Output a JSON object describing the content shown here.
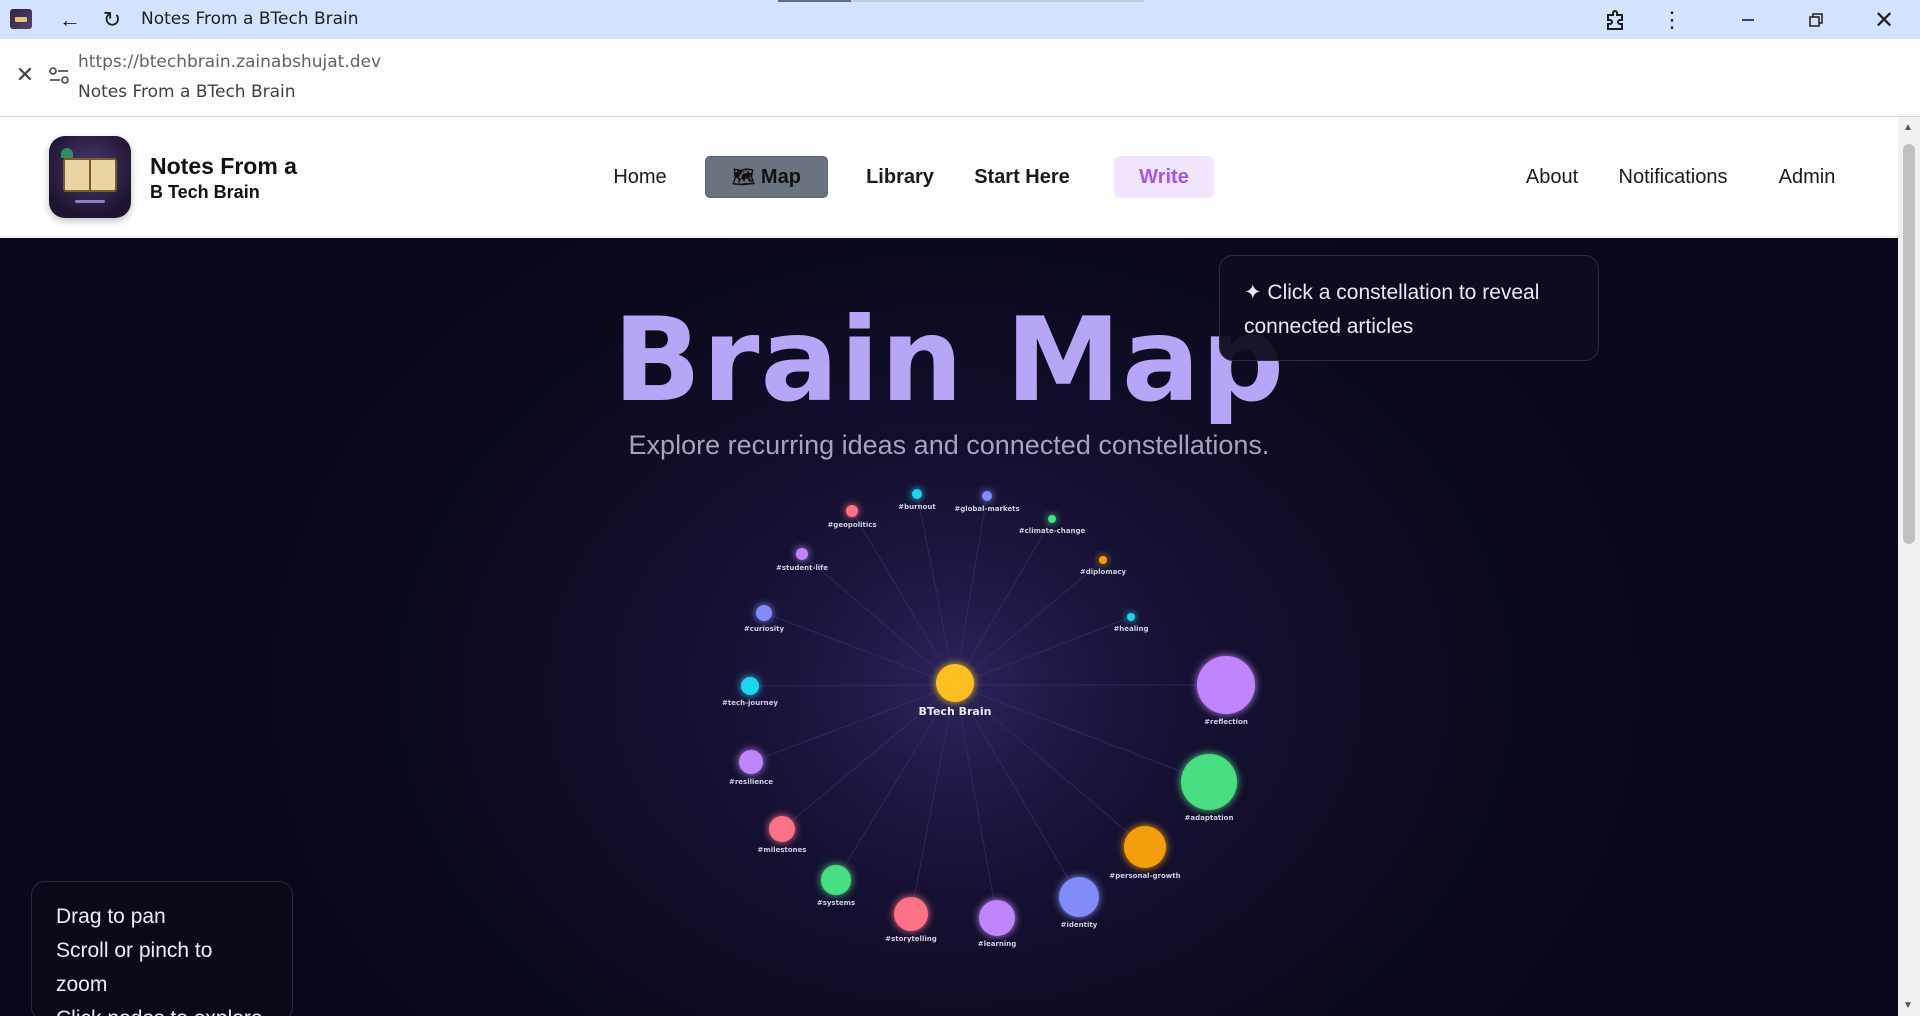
{
  "browser": {
    "title": "Notes From a BTech Brain",
    "url": "https://btechbrain.zainabshujat.dev",
    "url_subtitle": "Notes From a BTech Brain"
  },
  "site": {
    "brand_line1": "Notes From a",
    "brand_line2": "B Tech Brain",
    "nav": {
      "home": "Home",
      "map": "Map",
      "library": "Library",
      "start": "Start Here",
      "write": "Write",
      "about": "About",
      "notifications": "Notifications",
      "admin": "Admin"
    }
  },
  "map": {
    "title": "Brain Map",
    "subtitle": "Explore recurring ideas and connected constellations.",
    "tip_line1": "✦ Click a constellation to reveal",
    "tip_line2": "connected articles",
    "help": [
      "Drag to pan",
      "Scroll or pinch to zoom",
      "Click nodes to explore"
    ],
    "center": {
      "label": "BTech Brain",
      "color": "#fbbf24"
    },
    "nodes": [
      {
        "label": "#geopolitics",
        "color": "#fb7185",
        "size": 6
      },
      {
        "label": "#burnout",
        "color": "#22d3ee",
        "size": 5
      },
      {
        "label": "#global-markets",
        "color": "#818cf8",
        "size": 5
      },
      {
        "label": "#climate-change",
        "color": "#4ade80",
        "size": 4
      },
      {
        "label": "#diplomacy",
        "color": "#f59e0b",
        "size": 4
      },
      {
        "label": "#healing",
        "color": "#22d3ee",
        "size": 4
      },
      {
        "label": "#reflection",
        "color": "#c084fc",
        "size": 29
      },
      {
        "label": "#adaptation",
        "color": "#4ade80",
        "size": 28
      },
      {
        "label": "#personal-growth",
        "color": "#f59e0b",
        "size": 21
      },
      {
        "label": "#identity",
        "color": "#818cf8",
        "size": 20
      },
      {
        "label": "#learning",
        "color": "#c084fc",
        "size": 18
      },
      {
        "label": "#storytelling",
        "color": "#fb7185",
        "size": 17
      },
      {
        "label": "#systems",
        "color": "#4ade80",
        "size": 15
      },
      {
        "label": "#milestones",
        "color": "#fb7185",
        "size": 13
      },
      {
        "label": "#resilience",
        "color": "#c084fc",
        "size": 12
      },
      {
        "label": "#tech-journey",
        "color": "#22d3ee",
        "size": 9
      },
      {
        "label": "#curiosity",
        "color": "#818cf8",
        "size": 8
      },
      {
        "label": "#student-life",
        "color": "#c084fc",
        "size": 6
      }
    ]
  }
}
